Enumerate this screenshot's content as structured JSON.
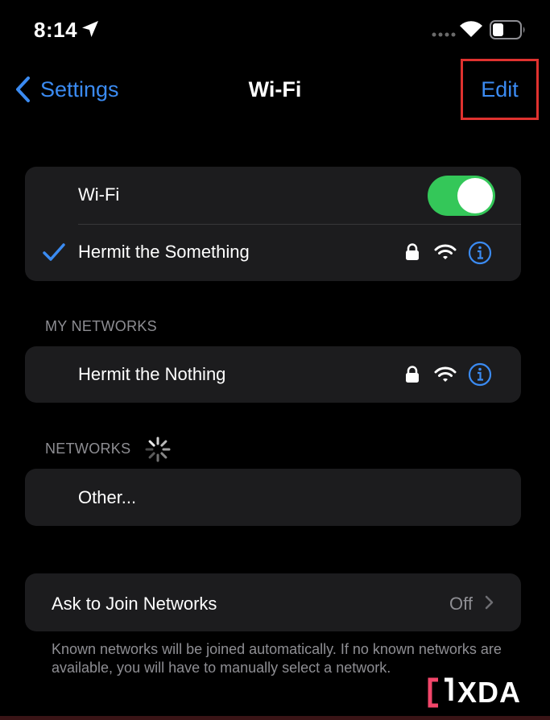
{
  "status_bar": {
    "time": "8:14"
  },
  "nav": {
    "back_label": "Settings",
    "title": "Wi-Fi",
    "edit_label": "Edit"
  },
  "wifi_group": {
    "toggle_label": "Wi-Fi",
    "toggle_on": true,
    "connected_network": "Hermit the Something"
  },
  "my_networks": {
    "header": "MY NETWORKS",
    "items": [
      {
        "name": "Hermit the Nothing"
      }
    ]
  },
  "networks": {
    "header": "NETWORKS",
    "other_label": "Other..."
  },
  "ask_to_join": {
    "label": "Ask to Join Networks",
    "value": "Off"
  },
  "footnote": "Known networks will be joined automatically. If no known networks are available, you will have to manually select a network.",
  "watermark": {
    "text": "XDA"
  },
  "colors": {
    "accent": "#3b8bf2",
    "toggle_on": "#34c759",
    "highlight_box": "#e0322f",
    "group_bg": "#1c1c1e",
    "secondary_text": "#8e8e93"
  },
  "icons": {
    "back": "chevron-left-icon",
    "location": "location-arrow-icon",
    "checkmark": "checkmark-icon",
    "lock": "lock-icon",
    "wifi": "wifi-icon",
    "info": "info-icon",
    "spinner": "spinner-icon",
    "chevron": "chevron-right-icon"
  }
}
